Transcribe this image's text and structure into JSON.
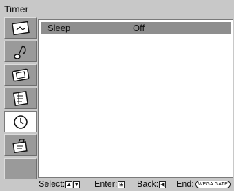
{
  "menu": {
    "title": "Timer",
    "icons": [
      {
        "name": "picture-icon",
        "selected": false
      },
      {
        "name": "sound-icon",
        "selected": false
      },
      {
        "name": "screen-icon",
        "selected": false
      },
      {
        "name": "channel-setup-icon",
        "selected": false
      },
      {
        "name": "timer-icon",
        "selected": true
      },
      {
        "name": "setup-icon",
        "selected": false
      },
      {
        "name": "empty-icon",
        "selected": false
      }
    ]
  },
  "content": {
    "rows": [
      {
        "label": "Sleep",
        "value": "Off"
      }
    ]
  },
  "footer": {
    "select_label": "Select:",
    "select_key_up": "▲",
    "select_key_down": "▼",
    "enter_label": "Enter:",
    "enter_key": "⊞",
    "back_label": "Back:",
    "back_key": "◀",
    "end_label": "End:",
    "end_key": "WEGA GATE"
  }
}
